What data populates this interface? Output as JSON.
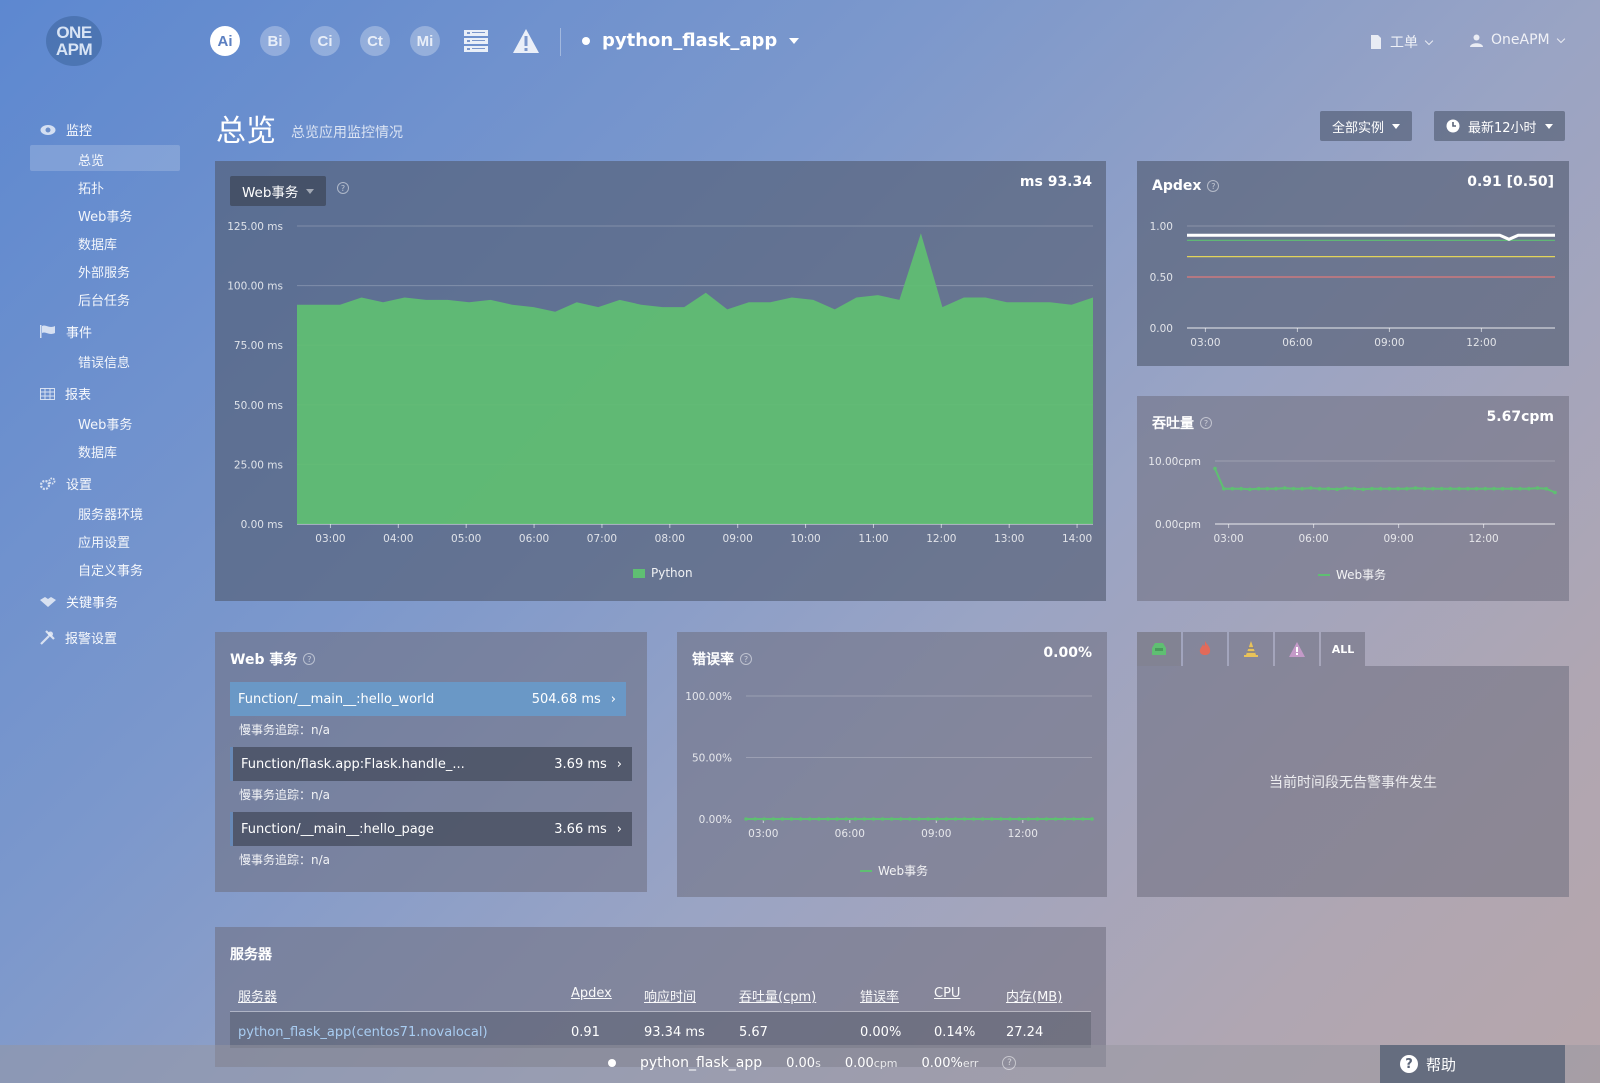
{
  "logo": {
    "line1": "ONE",
    "line2": "APM"
  },
  "topnav": {
    "icons": [
      {
        "letter": "Ai",
        "name": "ai-icon"
      },
      {
        "letter": "Bi",
        "name": "bi-icon"
      },
      {
        "letter": "Ci",
        "name": "ci-icon"
      },
      {
        "letter": "Ct",
        "name": "ct-icon"
      },
      {
        "letter": "Mi",
        "name": "mi-icon"
      }
    ],
    "app_name": "python_flask_app",
    "ticket": "工单",
    "user": "OneAPM"
  },
  "sidebar": {
    "sections": [
      {
        "label": "监控",
        "items": [
          "总览",
          "拓扑",
          "Web事务",
          "数据库",
          "外部服务",
          "后台任务"
        ]
      },
      {
        "label": "事件",
        "items": [
          "错误信息"
        ]
      },
      {
        "label": "报表",
        "items": [
          "Web事务",
          "数据库"
        ]
      },
      {
        "label": "设置",
        "items": [
          "服务器环境",
          "应用设置",
          "自定义事务"
        ]
      },
      {
        "label": "关键事务",
        "items": []
      },
      {
        "label": "报警设置",
        "items": []
      }
    ],
    "active_item": "总览"
  },
  "page": {
    "title": "总览",
    "subtitle": "总览应用监控情况",
    "instances_btn": "全部实例",
    "time_btn": "最新12小时"
  },
  "colors": {
    "green": "#5fbf72",
    "white": "#ffffff",
    "selected_row": "#6a98c6"
  },
  "main_chart": {
    "dropdown": "Web事务",
    "value": "93.34 ms",
    "legend": "Python"
  },
  "apdex_panel": {
    "title": "Apdex",
    "value": "0.91 [0.50]"
  },
  "throughput_panel": {
    "title": "吞吐量",
    "value": "5.67cpm",
    "legend": "Web事务"
  },
  "web_tx_panel": {
    "title": "Web 事务",
    "rows": [
      {
        "name": "Function/__main__:hello_world",
        "time": "504.68 ms",
        "sub": "慢事务追踪：n/a"
      },
      {
        "name": "Function/flask.app:Flask.handle_...",
        "time": "3.69 ms",
        "sub": "慢事务追踪：n/a"
      },
      {
        "name": "Function/__main__:hello_page",
        "time": "3.66 ms",
        "sub": "慢事务追踪：n/a"
      }
    ]
  },
  "error_panel": {
    "title": "错误率",
    "value": "0.00%",
    "legend": "Web事务"
  },
  "alert_panel": {
    "all_tab": "ALL",
    "empty_msg": "当前时间段无告警事件发生"
  },
  "servers": {
    "title": "服务器",
    "headers": [
      "服务器",
      "Apdex",
      "响应时间",
      "吞吐量(cpm)",
      "错误率",
      "CPU",
      "内存(MB)"
    ],
    "rows": [
      [
        "python_flask_app(centos71.novalocal)",
        "0.91",
        "93.34 ms",
        "5.67",
        "0.00%",
        "0.14%",
        "27.24"
      ]
    ]
  },
  "statusbar": {
    "app": "python_flask_app",
    "time": "0.00",
    "time_unit": "s",
    "cpm": "0.00",
    "cpm_unit": "cpm",
    "err": "0.00%",
    "err_unit": "err",
    "help": "帮助"
  },
  "chart_data": [
    {
      "type": "area",
      "id": "response_time",
      "x": [
        "02:30",
        "02:50",
        "03:10",
        "03:30",
        "03:50",
        "04:10",
        "04:30",
        "04:50",
        "05:10",
        "05:30",
        "05:50",
        "06:10",
        "06:30",
        "06:50",
        "07:10",
        "07:30",
        "07:50",
        "08:10",
        "08:30",
        "08:50",
        "09:10",
        "09:30",
        "09:50",
        "10:10",
        "10:30",
        "10:50",
        "11:10",
        "11:30",
        "11:50",
        "12:10",
        "12:30",
        "12:50",
        "13:10",
        "13:30",
        "13:50",
        "14:10"
      ],
      "series": [
        {
          "name": "Python",
          "values": [
            92,
            92,
            92,
            95,
            93,
            95,
            94,
            94,
            93,
            94,
            92,
            91,
            89,
            93,
            91,
            94,
            92,
            91,
            91,
            97,
            90,
            93,
            93,
            95,
            94,
            90,
            95,
            96,
            94,
            122,
            91,
            95,
            95,
            93,
            93,
            93,
            92,
            95
          ]
        }
      ],
      "x_ticks": [
        "03:00",
        "04:00",
        "05:00",
        "06:00",
        "07:00",
        "08:00",
        "09:00",
        "10:00",
        "11:00",
        "12:00",
        "13:00",
        "14:00"
      ],
      "y_ticks": [
        "0.00 ms",
        "25.00 ms",
        "50.00 ms",
        "75.00 ms",
        "100.00 ms",
        "125.00 ms"
      ],
      "ylim": [
        0,
        125
      ]
    },
    {
      "type": "line",
      "id": "apdex",
      "x_ticks": [
        "03:00",
        "06:00",
        "09:00",
        "12:00"
      ],
      "y_ticks": [
        "0.00",
        "0.50",
        "1.00"
      ],
      "ylim": [
        0,
        1
      ],
      "series": [
        {
          "color": "#ffffff",
          "values": [
            0.91,
            0.91,
            0.91,
            0.91,
            0.91,
            0.91,
            0.91,
            0.91,
            0.91,
            0.91,
            0.91,
            0.91,
            0.91,
            0.91,
            0.91,
            0.91,
            0.91,
            0.91,
            0.91,
            0.91,
            0.91,
            0.91,
            0.91,
            0.91,
            0.91,
            0.91,
            0.91,
            0.91,
            0.91,
            0.91,
            0.91,
            0.91,
            0.91,
            0.91,
            0.91,
            0.87,
            0.91,
            0.91,
            0.91,
            0.91,
            0.91
          ]
        },
        {
          "color": "#5fbf72",
          "values": [
            0.86,
            0.86
          ]
        },
        {
          "color": "#e2d45a",
          "values": [
            0.7,
            0.7
          ]
        },
        {
          "color": "#e07a7a",
          "values": [
            0.5,
            0.5
          ]
        }
      ]
    },
    {
      "type": "line",
      "id": "throughput",
      "x_ticks": [
        "03:00",
        "06:00",
        "09:00",
        "12:00"
      ],
      "y_ticks": [
        "0.00cpm",
        "10.00cpm"
      ],
      "ylim": [
        0,
        10
      ],
      "series": [
        {
          "name": "Web事务",
          "values": [
            8.8,
            5.6,
            5.6,
            5.6,
            5.5,
            5.6,
            5.6,
            5.6,
            5.7,
            5.6,
            5.6,
            5.7,
            5.6,
            5.6,
            5.5,
            5.7,
            5.6,
            5.5,
            5.6,
            5.6,
            5.6,
            5.6,
            5.6,
            5.7,
            5.6,
            5.6,
            5.6,
            5.6,
            5.6,
            5.6,
            5.6,
            5.6,
            5.6,
            5.6,
            5.6,
            5.6,
            5.6,
            5.7,
            5.6,
            5.0
          ]
        }
      ]
    },
    {
      "type": "line",
      "id": "error_rate",
      "x_ticks": [
        "03:00",
        "06:00",
        "09:00",
        "12:00"
      ],
      "y_ticks": [
        "0.00%",
        "50.00%",
        "100.00%"
      ],
      "ylim": [
        0,
        100
      ],
      "series": [
        {
          "name": "Web事务",
          "values": [
            0,
            0,
            0,
            0,
            0,
            0,
            0,
            0,
            0,
            0,
            0,
            0,
            0,
            0,
            0,
            0,
            0,
            0,
            0,
            0,
            0,
            0,
            0,
            0,
            0,
            0,
            0,
            0,
            0,
            0,
            0,
            0,
            0,
            0,
            0,
            0,
            0,
            0,
            0
          ]
        }
      ]
    }
  ]
}
